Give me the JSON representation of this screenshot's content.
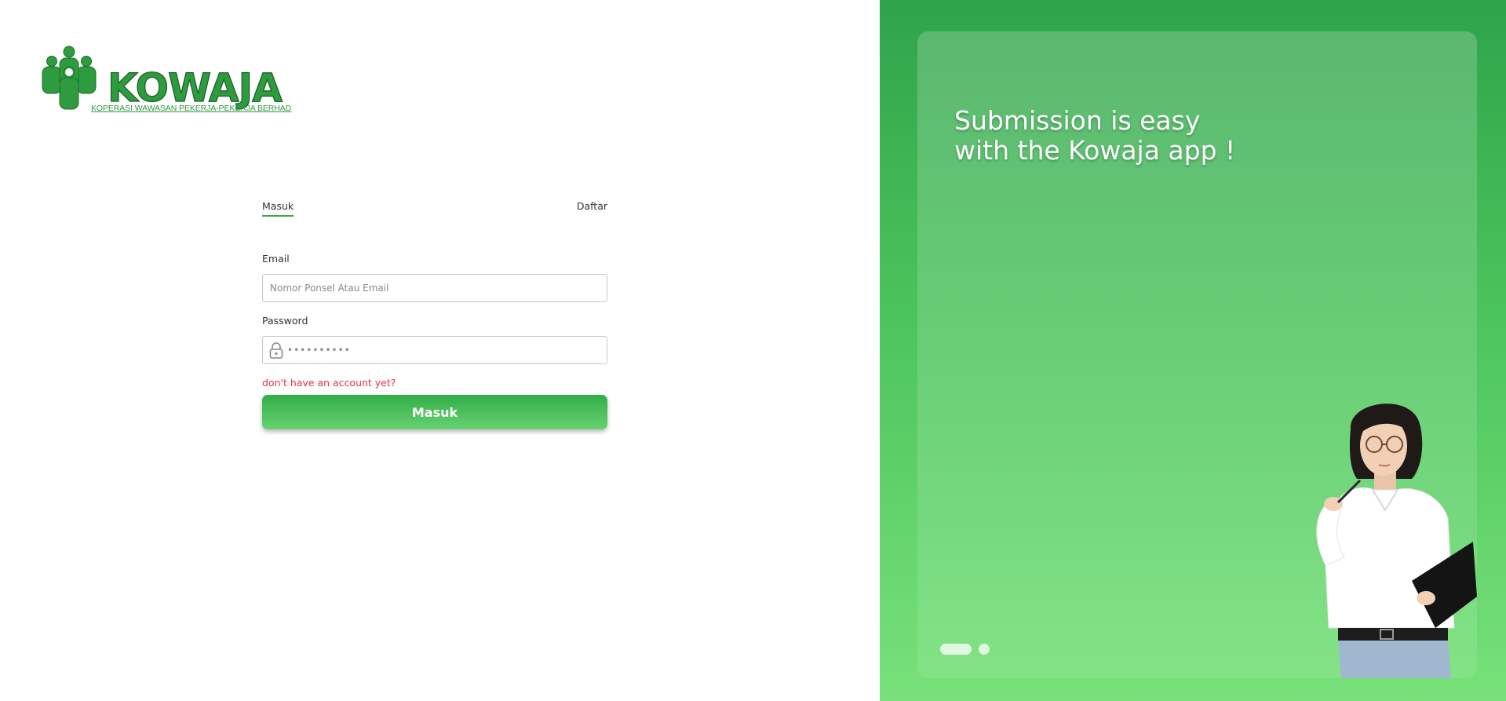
{
  "brand": {
    "name": "KOWAJA",
    "subtitle": "KOPERASI WAWASAN PEKERJA-PEKERJA BERHAD",
    "primary_color": "#38a84c"
  },
  "auth": {
    "tabs": {
      "login": "Masuk",
      "register": "Daftar"
    },
    "active_tab": "Masuk",
    "email": {
      "label": "Email",
      "placeholder": "Nomor Ponsel Atau Email",
      "value": ""
    },
    "password": {
      "label": "Password",
      "placeholder": "••••••••••",
      "icon": "lock-icon"
    },
    "signup_link": "don't have an account yet?",
    "submit_label": "Masuk",
    "link_color": "#e0344a"
  },
  "promo": {
    "headline_line1": "Submission is easy",
    "headline_line2": "with the Kowaja app !",
    "carousel": {
      "slides": 2,
      "active_index": 0
    },
    "illustration": "woman-thinking-with-pen-and-clipboard"
  }
}
